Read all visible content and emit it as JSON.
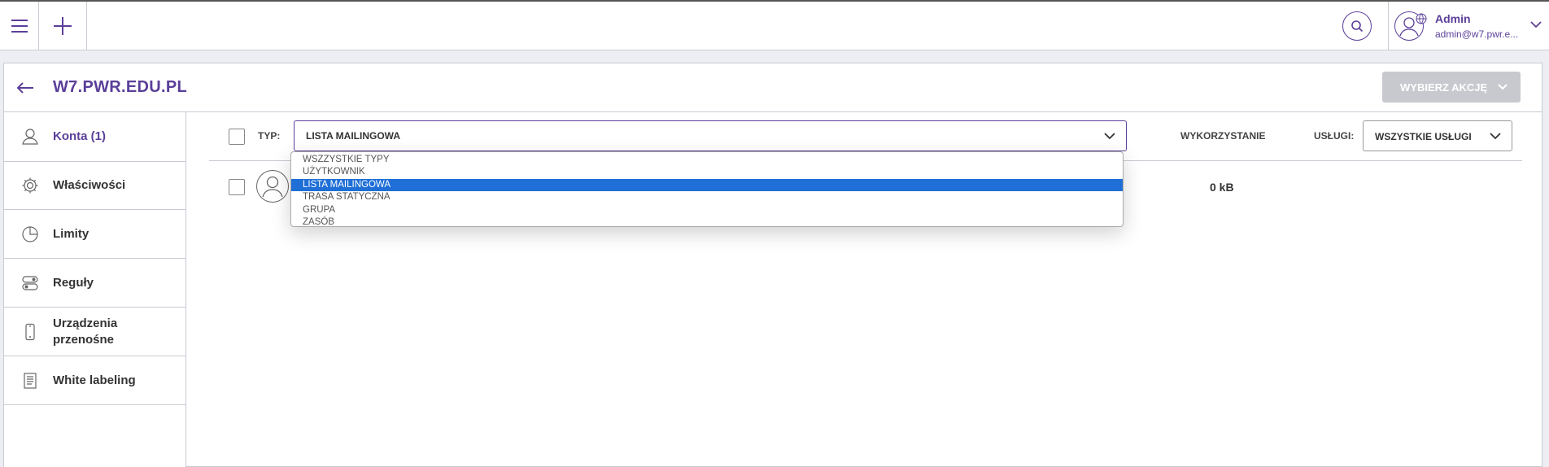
{
  "topbar": {
    "menu_icon": "hamburger-icon",
    "add_icon": "plus-icon",
    "search_icon": "search-icon",
    "user": {
      "name": "Admin",
      "email": "admin@w7.pwr.e..."
    }
  },
  "header": {
    "title": "W7.PWR.EDU.PL",
    "action_button": "WYBIERZ AKCJĘ"
  },
  "sidebar": {
    "items": [
      {
        "label": "Konta (1)",
        "icon": "user-icon"
      },
      {
        "label": "Właściwości",
        "icon": "gear-icon"
      },
      {
        "label": "Limity",
        "icon": "pie-chart-icon"
      },
      {
        "label": "Reguły",
        "icon": "toggles-icon"
      },
      {
        "label": "Urządzenia\nprzenośne",
        "icon": "phone-icon"
      },
      {
        "label": "White labeling",
        "icon": "document-icon"
      }
    ]
  },
  "filters": {
    "type_label": "TYP:",
    "type_value": "LISTA MAILINGOWA",
    "type_options": [
      "WSZZYSTKIE TYPY",
      "UŻYTKOWNIK",
      "LISTA MAILINGOWA",
      "TRASA STATYCZNA",
      "GRUPA",
      "ZASÓB"
    ],
    "type_selected_index": 2,
    "usage_label": "WYKORZYSTANIE",
    "services_label": "USŁUGI:",
    "services_value": "WSZYSTKIE USŁUGI"
  },
  "rows": [
    {
      "usage": "0 kB"
    }
  ],
  "colors": {
    "accent": "#5b3f99",
    "selected": "#1f6fd6",
    "disabled_button": "#c8c9cf"
  }
}
